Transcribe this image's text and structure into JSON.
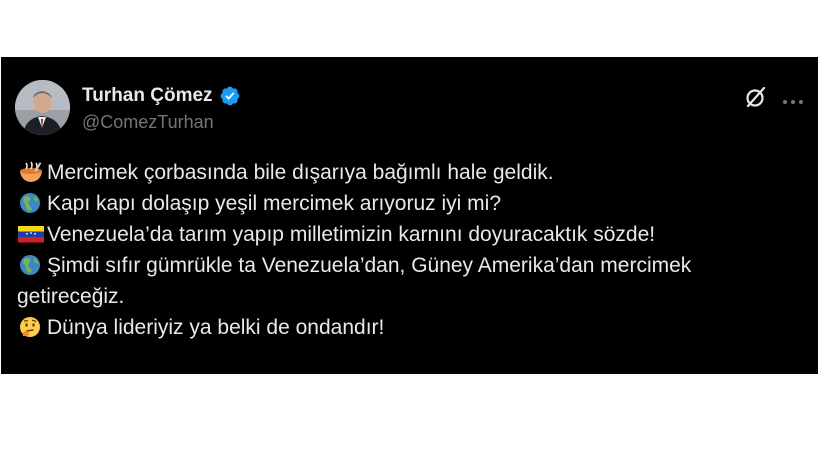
{
  "author": {
    "display_name": "Turhan Çömez",
    "handle": "@ComezTurhan",
    "verified": true,
    "avatar_icon": "profile-photo"
  },
  "actions": {
    "grok_icon": "slashed-circle-icon",
    "more_icon": "more-options-icon"
  },
  "tweet": {
    "lines": [
      {
        "emoji": "bowl-with-spoon",
        "text": "Mercimek çorbasında bile dışarıya bağımlı hale geldik."
      },
      {
        "emoji": "globe-americas",
        "text": "Kapı kapı dolaşıp yeşil mercimek arıyoruz iyi mi?"
      },
      {
        "emoji": "flag-venezuela",
        "text": "Venezuela’da tarım yapıp milletimizin karnını doyuracaktık sözde!"
      },
      {
        "emoji": "globe-americas",
        "text": "Şimdi sıfır gümrükle ta Venezuela’dan, Güney Amerika’dan mercimek"
      },
      {
        "emoji": "",
        "text": "getireceğiz."
      },
      {
        "emoji": "thinking-face",
        "text": "Dünya lideriyiz ya belki de ondandır!"
      }
    ]
  },
  "colors": {
    "background": "#000000",
    "text": "#e7e9ea",
    "secondary_text": "#71767b",
    "verified_badge": "#1d9bf0"
  }
}
